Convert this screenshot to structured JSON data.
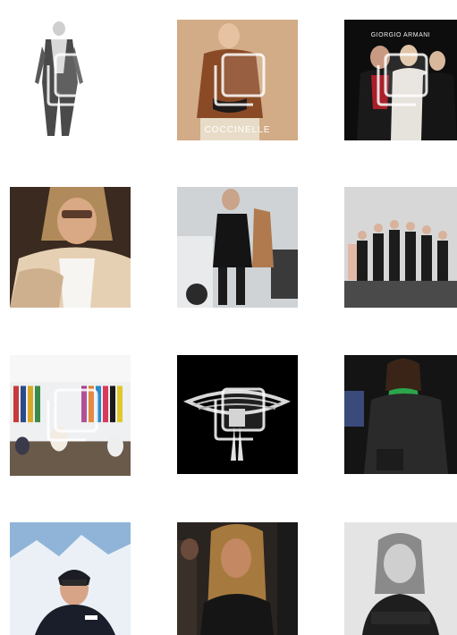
{
  "grid": {
    "tiles": [
      {
        "name": "post-fashion-sketch",
        "carousel": true,
        "top_text": "",
        "bottom_text": ""
      },
      {
        "name": "post-coccinelle-model",
        "carousel": true,
        "top_text": "",
        "bottom_text": "COCCINELLE"
      },
      {
        "name": "post-armani-event",
        "carousel": true,
        "top_text": "GIORGIO ARMANI",
        "bottom_text": ""
      },
      {
        "name": "post-fur-coat-portrait",
        "carousel": false,
        "top_text": "",
        "bottom_text": ""
      },
      {
        "name": "post-street-style",
        "carousel": false,
        "top_text": "",
        "bottom_text": ""
      },
      {
        "name": "post-group-photo",
        "carousel": false,
        "top_text": "",
        "bottom_text": ""
      },
      {
        "name": "post-store-interior",
        "carousel": true,
        "top_text": "",
        "bottom_text": ""
      },
      {
        "name": "post-jewelry-necklace",
        "carousel": true,
        "top_text": "",
        "bottom_text": ""
      },
      {
        "name": "post-leather-coat",
        "carousel": false,
        "top_text": "",
        "bottom_text": ""
      },
      {
        "name": "post-ski-portrait",
        "carousel": false,
        "top_text": "",
        "bottom_text": ""
      },
      {
        "name": "post-evening-blonde",
        "carousel": false,
        "top_text": "",
        "bottom_text": ""
      },
      {
        "name": "post-bw-portrait",
        "carousel": false,
        "top_text": "",
        "bottom_text": ""
      }
    ],
    "icons": {
      "carousel": "multiple-images-icon"
    }
  }
}
